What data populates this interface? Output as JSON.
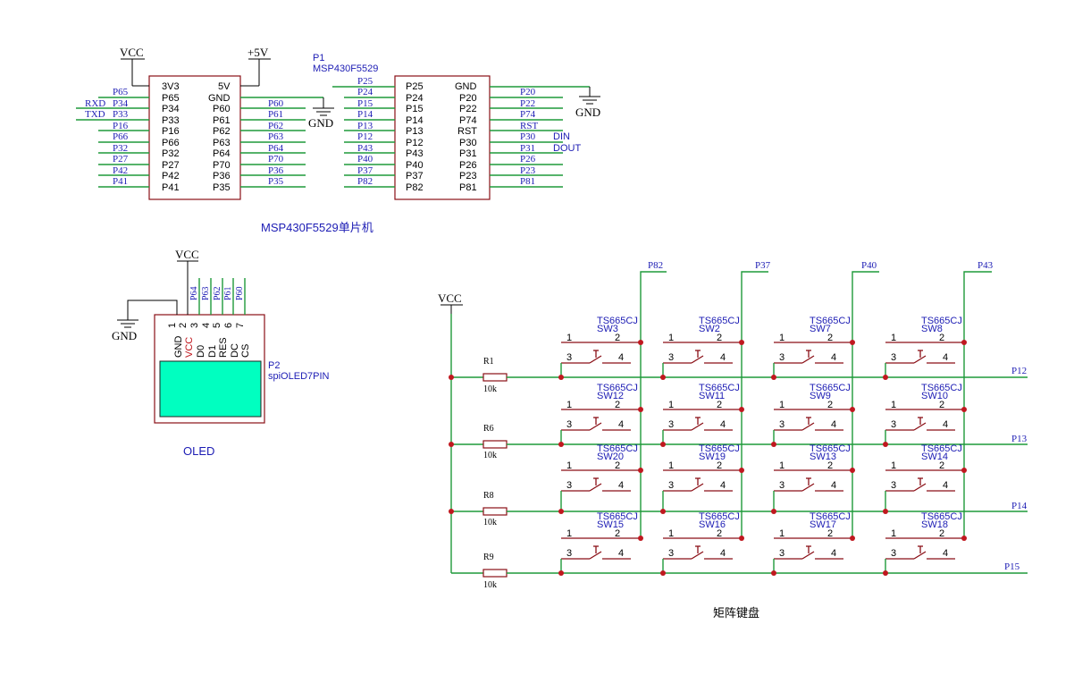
{
  "mcu": {
    "designator": "P1",
    "part": "MSP430F5529",
    "caption": "MSP430F5529单片机",
    "left_header": {
      "left_pins": [
        "3V3",
        "P65",
        "P34",
        "P33",
        "P16",
        "P66",
        "P32",
        "P27",
        "P42",
        "P41"
      ],
      "right_pins": [
        "5V",
        "GND",
        "P60",
        "P61",
        "P62",
        "P63",
        "P64",
        "P70",
        "P36",
        "P35"
      ],
      "left_nets": [
        "P65",
        "P34",
        "P33",
        "P16",
        "P66",
        "P32",
        "P27",
        "P42",
        "P41"
      ],
      "right_nets": [
        "P60",
        "P61",
        "P62",
        "P63",
        "P64",
        "P70",
        "P36",
        "P35"
      ],
      "uart_labels": [
        "RXD",
        "TXD"
      ]
    },
    "right_header": {
      "left_pins": [
        "P25",
        "P24",
        "P15",
        "P14",
        "P13",
        "P12",
        "P43",
        "P40",
        "P37",
        "P82"
      ],
      "right_pins": [
        "GND",
        "P20",
        "P22",
        "P74",
        "RST",
        "P30",
        "P31",
        "P26",
        "P23",
        "P81"
      ],
      "left_nets": [
        "P25",
        "P24",
        "P15",
        "P14",
        "P13",
        "P12",
        "P43",
        "P40",
        "P37",
        "P82"
      ],
      "right_nets": [
        "P20",
        "P22",
        "P74",
        "RST",
        "P30",
        "P31",
        "P26",
        "P23",
        "P81"
      ],
      "spi_labels": [
        "DIN",
        "DOUT"
      ]
    }
  },
  "power": {
    "vcc": "VCC",
    "plus5v": "+5V",
    "gnd": "GND"
  },
  "oled": {
    "designator": "P2",
    "part": "spiOLED7PIN",
    "caption": "OLED",
    "pin_numbers": [
      "1",
      "2",
      "3",
      "4",
      "5",
      "6",
      "7"
    ],
    "pin_names": [
      "GND",
      "VCC",
      "D0",
      "D1",
      "RES",
      "DC",
      "CS"
    ],
    "nets": [
      "P64",
      "P63",
      "P62",
      "P61",
      "P60"
    ],
    "screen_color": "#00ffc0"
  },
  "keypad": {
    "caption": "矩阵键盘",
    "part": "TS665CJ",
    "pin_labels": [
      "1",
      "2",
      "3",
      "4"
    ],
    "column_nets": [
      "P82",
      "P37",
      "P40",
      "P43"
    ],
    "row_nets": [
      "P12",
      "P13",
      "P14",
      "P15"
    ],
    "resistors": [
      {
        "ref": "R1",
        "value": "10k"
      },
      {
        "ref": "R6",
        "value": "10k"
      },
      {
        "ref": "R8",
        "value": "10k"
      },
      {
        "ref": "R9",
        "value": "10k"
      }
    ],
    "switches": [
      [
        "SW3",
        "SW2",
        "SW7",
        "SW8"
      ],
      [
        "SW12",
        "SW11",
        "SW9",
        "SW10"
      ],
      [
        "SW20",
        "SW19",
        "SW13",
        "SW14"
      ],
      [
        "SW15",
        "SW16",
        "SW17",
        "SW18"
      ]
    ]
  },
  "colors": {
    "wire": "#1f9a3a",
    "net_label": "#1c1cb4",
    "pin_number": "#c0181f",
    "component_outline": "#8a0f16",
    "text": "#000000"
  }
}
